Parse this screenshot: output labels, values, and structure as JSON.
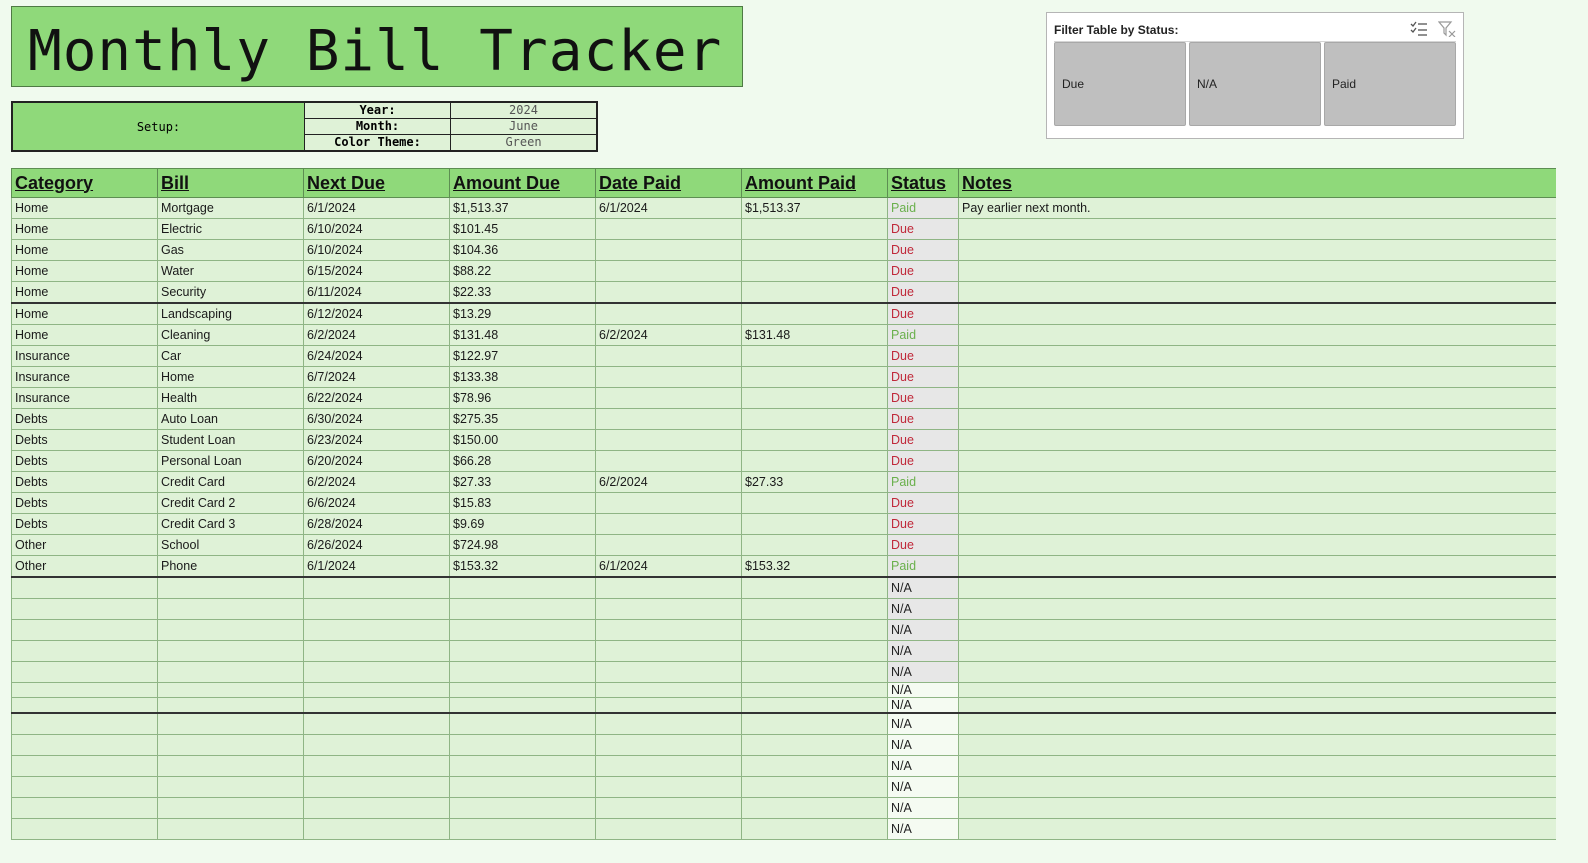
{
  "title": "Monthly Bill Tracker",
  "setup": {
    "label": "Setup:",
    "fields": [
      {
        "key": "Year:",
        "value": "2024"
      },
      {
        "key": "Month:",
        "value": "June"
      },
      {
        "key": "Color Theme:",
        "value": "Green"
      }
    ]
  },
  "slicer": {
    "title": "Filter Table by Status:",
    "multiselect_icon": "multi-select-icon",
    "clear_filter_icon": "clear-filter-icon",
    "options": [
      "Due",
      "N/A",
      "Paid"
    ]
  },
  "table": {
    "columns": [
      "Category",
      "Bill",
      "Next Due",
      "Amount Due",
      "Date Paid",
      "Amount Paid",
      "Status",
      "Notes"
    ],
    "rows": [
      [
        "Home",
        "Mortgage",
        "6/1/2024",
        "$1,513.37",
        "6/1/2024",
        "$1,513.37",
        "Paid",
        "Pay earlier next month."
      ],
      [
        "Home",
        "Electric",
        "6/10/2024",
        "$101.45",
        "",
        "",
        "Due",
        ""
      ],
      [
        "Home",
        "Gas",
        "6/10/2024",
        "$104.36",
        "",
        "",
        "Due",
        ""
      ],
      [
        "Home",
        "Water",
        "6/15/2024",
        "$88.22",
        "",
        "",
        "Due",
        ""
      ],
      [
        "Home",
        "Security",
        "6/11/2024",
        "$22.33",
        "",
        "",
        "Due",
        ""
      ],
      [
        "Home",
        "Landscaping",
        "6/12/2024",
        "$13.29",
        "",
        "",
        "Due",
        ""
      ],
      [
        "Home",
        "Cleaning",
        "6/2/2024",
        "$131.48",
        "6/2/2024",
        "$131.48",
        "Paid",
        ""
      ],
      [
        "Insurance",
        "Car",
        "6/24/2024",
        "$122.97",
        "",
        "",
        "Due",
        ""
      ],
      [
        "Insurance",
        "Home",
        "6/7/2024",
        "$133.38",
        "",
        "",
        "Due",
        ""
      ],
      [
        "Insurance",
        "Health",
        "6/22/2024",
        "$78.96",
        "",
        "",
        "Due",
        ""
      ],
      [
        "Debts",
        "Auto Loan",
        "6/30/2024",
        "$275.35",
        "",
        "",
        "Due",
        ""
      ],
      [
        "Debts",
        "Student Loan",
        "6/23/2024",
        "$150.00",
        "",
        "",
        "Due",
        ""
      ],
      [
        "Debts",
        "Personal Loan",
        "6/20/2024",
        "$66.28",
        "",
        "",
        "Due",
        ""
      ],
      [
        "Debts",
        "Credit Card",
        "6/2/2024",
        "$27.33",
        "6/2/2024",
        "$27.33",
        "Paid",
        ""
      ],
      [
        "Debts",
        "Credit Card 2",
        "6/6/2024",
        "$15.83",
        "",
        "",
        "Due",
        ""
      ],
      [
        "Debts",
        "Credit Card 3",
        "6/28/2024",
        "$9.69",
        "",
        "",
        "Due",
        ""
      ],
      [
        "Other",
        "School",
        "6/26/2024",
        "$724.98",
        "",
        "",
        "Due",
        ""
      ],
      [
        "Other",
        "Phone",
        "6/1/2024",
        "$153.32",
        "6/1/2024",
        "$153.32",
        "Paid",
        ""
      ],
      [
        "",
        "",
        "",
        "",
        "",
        "",
        "N/A",
        ""
      ],
      [
        "",
        "",
        "",
        "",
        "",
        "",
        "N/A",
        ""
      ],
      [
        "",
        "",
        "",
        "",
        "",
        "",
        "N/A",
        ""
      ],
      [
        "",
        "",
        "",
        "",
        "",
        "",
        "N/A",
        ""
      ],
      [
        "",
        "",
        "",
        "",
        "",
        "",
        "N/A",
        ""
      ],
      [
        "",
        "",
        "",
        "",
        "",
        "",
        "N/A",
        ""
      ],
      [
        "",
        "",
        "",
        "",
        "",
        "",
        "N/A",
        ""
      ],
      [
        "",
        "",
        "",
        "",
        "",
        "",
        "N/A",
        ""
      ],
      [
        "",
        "",
        "",
        "",
        "",
        "",
        "N/A",
        ""
      ],
      [
        "",
        "",
        "",
        "",
        "",
        "",
        "N/A",
        ""
      ],
      [
        "",
        "",
        "",
        "",
        "",
        "",
        "N/A",
        ""
      ],
      [
        "",
        "",
        "",
        "",
        "",
        "",
        "N/A",
        ""
      ],
      [
        "",
        "",
        "",
        "",
        "",
        "",
        "N/A",
        ""
      ]
    ]
  },
  "colors": {
    "header_green": "#8fd97a",
    "cell_green": "#dff2d7",
    "paid": "#6ab04c",
    "due": "#c0283a"
  }
}
